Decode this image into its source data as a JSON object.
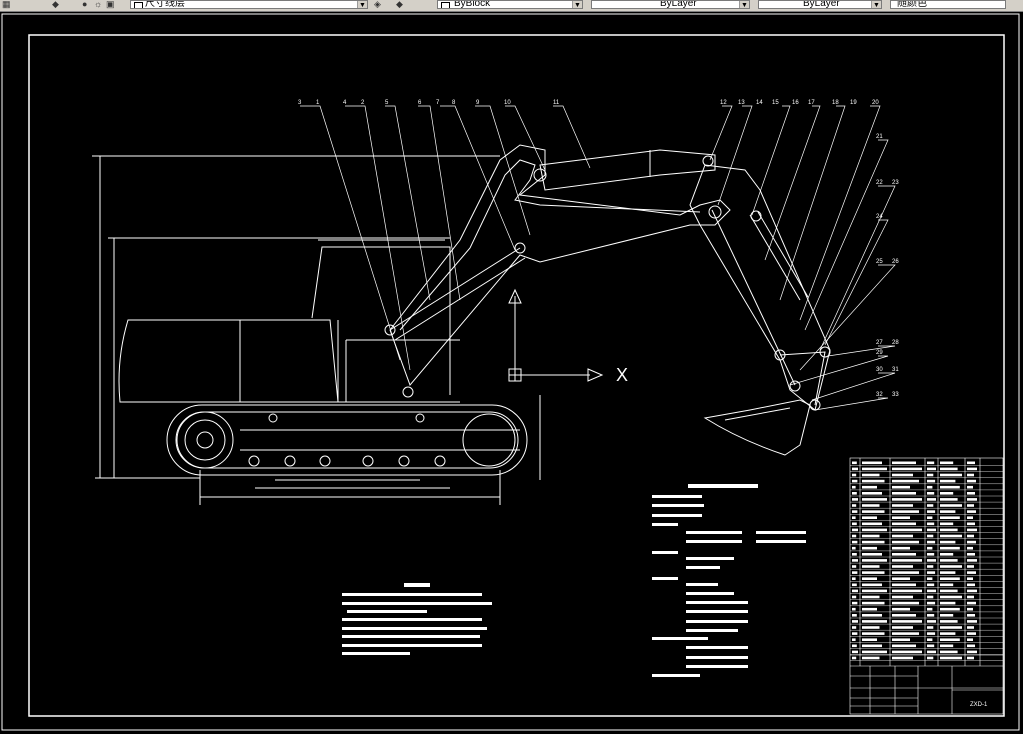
{
  "toolbar": {
    "layer_combo": "尺寸线层",
    "color_combo": "ByBlock",
    "linetype_combo": "ByLayer",
    "lineweight_combo": "ByLayer",
    "plotstyle_combo": "随颜色"
  },
  "drawing": {
    "section_marker": "X",
    "callouts": [
      "3",
      "1",
      "4",
      "2",
      "5",
      "6",
      "7",
      "8",
      "9",
      "10",
      "11",
      "12",
      "13",
      "14",
      "15",
      "16",
      "17",
      "18",
      "19",
      "20",
      "21",
      "22",
      "23",
      "24",
      "25",
      "26",
      "27",
      "28",
      "29",
      "30",
      "31",
      "32",
      "33"
    ],
    "drawing_no": "ZXD-1"
  },
  "colors": {
    "background": "#000000",
    "linework": "#ffffff",
    "toolbar": "#d4d0c8"
  }
}
